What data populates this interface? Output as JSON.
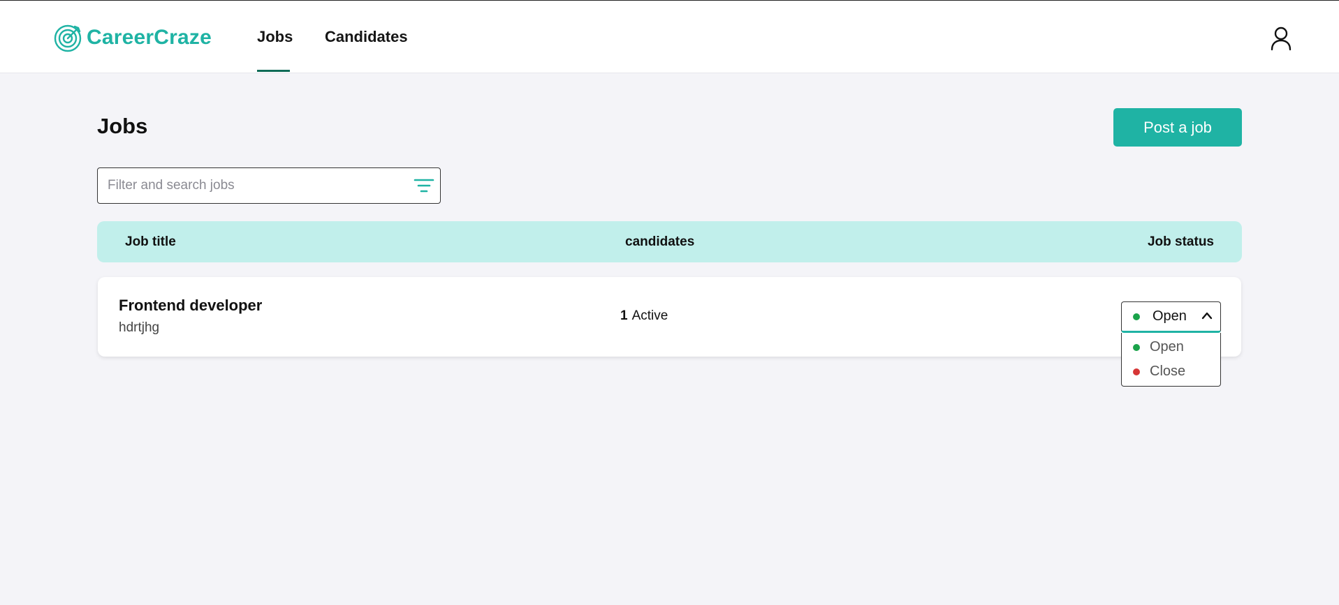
{
  "app": {
    "name": "CareerCraze",
    "accent": "#1fb3a4"
  },
  "nav": {
    "items": [
      {
        "label": "Jobs",
        "active": true
      },
      {
        "label": "Candidates",
        "active": false
      }
    ]
  },
  "header": {
    "user_icon": "user-icon"
  },
  "page": {
    "title": "Jobs",
    "post_button": "Post a job",
    "search": {
      "placeholder": "Filter and search jobs",
      "value": "",
      "icon": "filter-icon"
    }
  },
  "table": {
    "columns": [
      "Job title",
      "candidates",
      "Job status"
    ],
    "rows": [
      {
        "title": "Frontend developer",
        "subtitle": "hdrtjhg",
        "candidates_count": "1",
        "candidates_label": "Active",
        "status": "Open"
      }
    ]
  },
  "status_dropdown": {
    "expanded": true,
    "options": [
      {
        "label": "Open",
        "color": "#1aa34a"
      },
      {
        "label": "Close",
        "color": "#d63636"
      }
    ]
  }
}
